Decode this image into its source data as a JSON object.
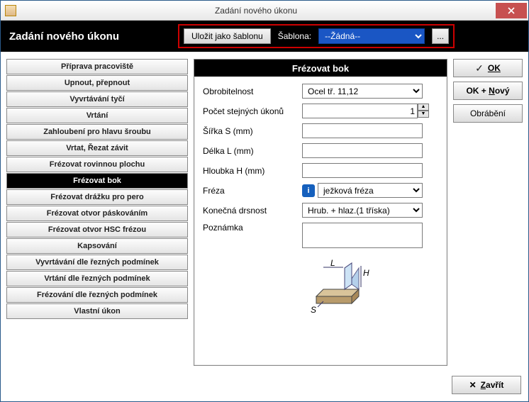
{
  "window": {
    "title": "Zadání nového úkonu"
  },
  "header": {
    "title": "Zadání nového úkonu",
    "save_template": "Uložit jako šablonu",
    "template_label": "Šablona:",
    "template_value": "--Žádná--",
    "browse": "..."
  },
  "operations": [
    "Příprava pracoviště",
    "Upnout, přepnout",
    "Vyvrtávání tyčí",
    "Vrtání",
    "Zahloubení pro hlavu šroubu",
    "Vrtat, Řezat závit",
    "Frézovat rovinnou plochu",
    "Frézovat bok",
    "Frézovat drážku pro pero",
    "Frézovat otvor páskováním",
    "Frézovat otvor HSC frézou",
    "Kapsování",
    "Vyvrtávání dle řezných podmínek",
    "Vrtání dle řezných podmínek",
    "Frézování dle řezných podmínek",
    "Vlastní úkon"
  ],
  "selected_index": 7,
  "panel": {
    "title": "Frézovat bok",
    "labels": {
      "machinability": "Obrobitelnost",
      "count": "Počet stejných úkonů",
      "width": "Šířka S (mm)",
      "length": "Délka L (mm)",
      "depth": "Hloubka H (mm)",
      "cutter": "Fréza",
      "roughness": "Konečná drsnost",
      "note": "Poznámka"
    },
    "values": {
      "machinability": "Ocel tř. 11,12",
      "count": "1",
      "width": "",
      "length": "",
      "depth": "",
      "cutter": "ježková fréza",
      "roughness": "Hrub. + hlaz.(1 tříska)",
      "note": ""
    },
    "diagram_labels": {
      "L": "L",
      "H": "H",
      "S": "S"
    }
  },
  "buttons": {
    "ok": "OK",
    "ok_new_prefix": "OK + ",
    "ok_new_u": "N",
    "ok_new_suffix": "ový",
    "machining": "Obrábění",
    "close_prefix": "",
    "close_u": "Z",
    "close_suffix": "avřít"
  }
}
